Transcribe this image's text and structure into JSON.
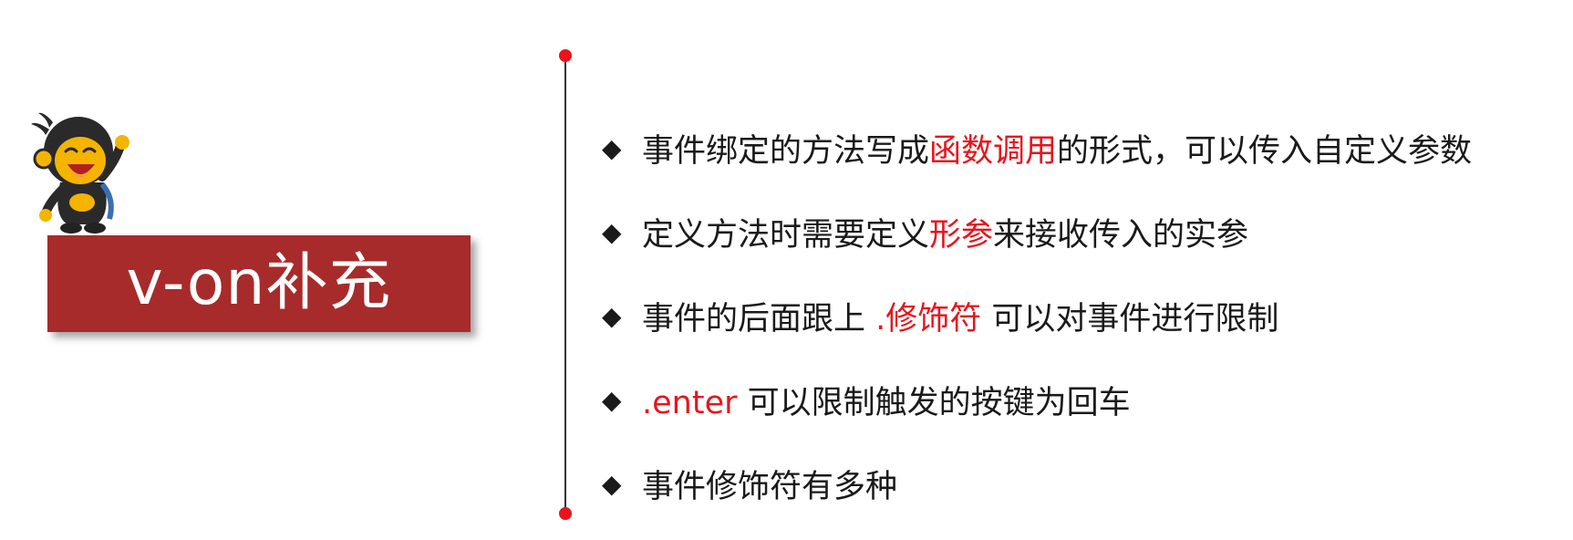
{
  "title": "v-on补充",
  "colors": {
    "banner": "#a72b2a",
    "highlight": "#e8141c",
    "text": "#1a1a1a",
    "divider_dot": "#e8141c"
  },
  "bullet_icon": "diamond-bullet-icon",
  "bullets": [
    {
      "segments": [
        {
          "text": "事件绑定的方法写成",
          "highlight": false
        },
        {
          "text": "函数调用",
          "highlight": true
        },
        {
          "text": "的形式，可以传入自定义参数",
          "highlight": false
        }
      ]
    },
    {
      "segments": [
        {
          "text": "定义方法时需要定义",
          "highlight": false
        },
        {
          "text": "形参",
          "highlight": true
        },
        {
          "text": "来接收传入的实参",
          "highlight": false
        }
      ]
    },
    {
      "segments": [
        {
          "text": "事件的后面跟上 ",
          "highlight": false
        },
        {
          "text": ".修饰符",
          "highlight": true
        },
        {
          "text": " 可以对事件进行限制",
          "highlight": false
        }
      ]
    },
    {
      "segments": [
        {
          "text": ".enter",
          "highlight": true
        },
        {
          "text": " 可以限制触发的按键为回车",
          "highlight": false
        }
      ]
    },
    {
      "segments": [
        {
          "text": "事件修饰符有多种",
          "highlight": false
        }
      ]
    }
  ]
}
